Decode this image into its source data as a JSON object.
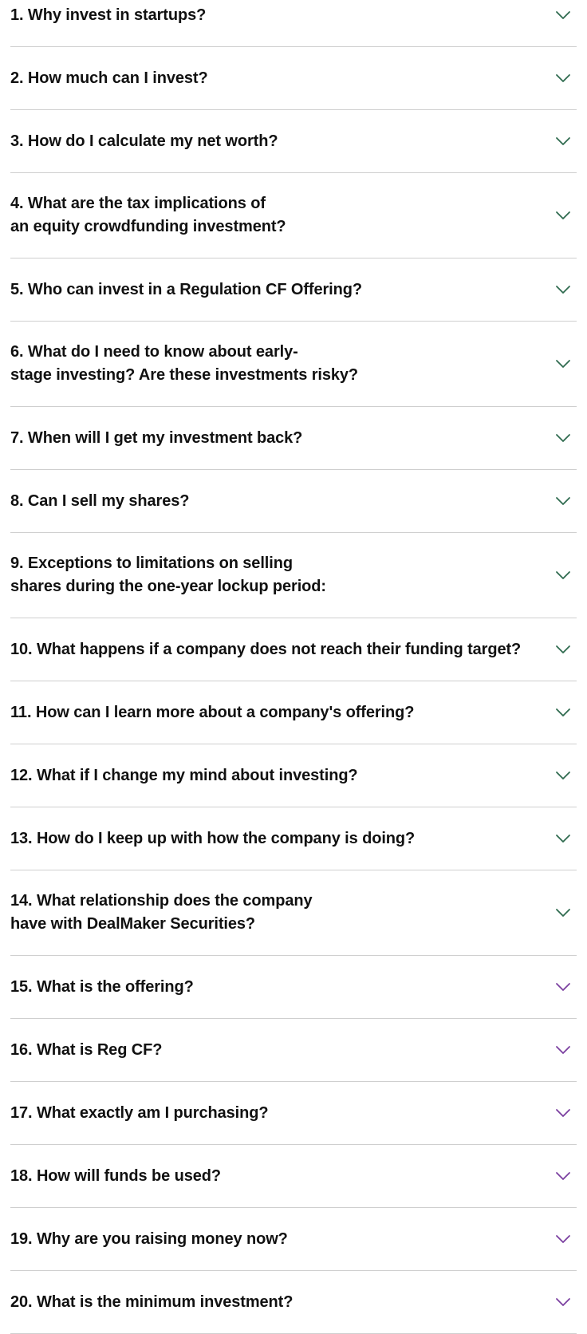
{
  "faq": {
    "items": [
      {
        "question": "1. Why invest in startups?",
        "chevron_color": "#2f6b4f"
      },
      {
        "question": "2. How much can I invest?",
        "chevron_color": "#2f6b4f"
      },
      {
        "question": "3. How do I calculate my net worth?",
        "chevron_color": "#2f6b4f"
      },
      {
        "question": "4. What are the tax implications of\nan equity crowdfunding investment?",
        "chevron_color": "#2f6b4f"
      },
      {
        "question": "5. Who can invest in a Regulation CF Offering?",
        "chevron_color": "#2f6b4f"
      },
      {
        "question": "6. What do I need to know about early-\nstage investing? Are these investments risky?",
        "chevron_color": "#2f6b4f"
      },
      {
        "question": "7. When will I get my investment back?",
        "chevron_color": "#2f6b4f"
      },
      {
        "question": "8. Can I sell my shares?",
        "chevron_color": "#2f6b4f"
      },
      {
        "question": "9. Exceptions to limitations on selling\nshares during the one-year lockup period:",
        "chevron_color": "#2f6b4f"
      },
      {
        "question": "10. What happens if a company does not reach their funding target?",
        "chevron_color": "#2f6b4f"
      },
      {
        "question": "11. How can I learn more about a company's offering?",
        "chevron_color": "#2f6b4f"
      },
      {
        "question": "12. What if I change my mind about investing?",
        "chevron_color": "#2f6b4f"
      },
      {
        "question": "13. How do I keep up with how the company is doing?",
        "chevron_color": "#2f6b4f"
      },
      {
        "question": "14. What relationship does the company\nhave with DealMaker Securities?",
        "chevron_color": "#2f6b4f"
      },
      {
        "question": "15. What is the offering?",
        "chevron_color": "#7b3fa0"
      },
      {
        "question": "16. What is Reg CF?",
        "chevron_color": "#7b3fa0"
      },
      {
        "question": "17. What exactly am I purchasing?",
        "chevron_color": "#7b3fa0"
      },
      {
        "question": "18. How will funds be used?",
        "chevron_color": "#7b3fa0"
      },
      {
        "question": "19. Why are you raising money now?",
        "chevron_color": "#7b3fa0"
      },
      {
        "question": "20. What is the minimum investment?",
        "chevron_color": "#7b3fa0"
      }
    ],
    "chevron_icon": "chevron-down-icon"
  }
}
